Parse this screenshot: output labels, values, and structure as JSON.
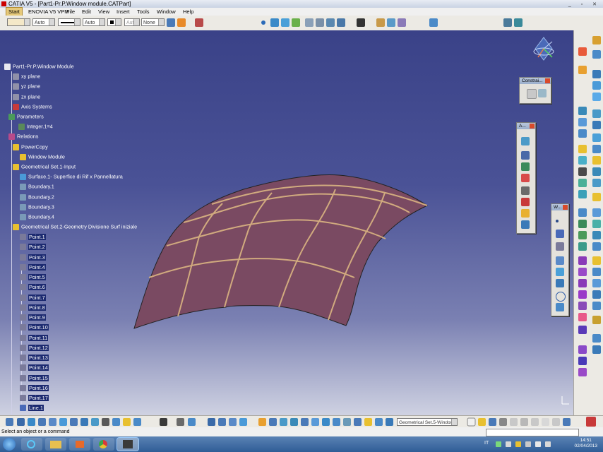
{
  "window": {
    "title": "CATIA V5 - [Part1-Pr.P.Window module.CATPart]",
    "controls": "_ ▫ ✕"
  },
  "menu": {
    "items": [
      "Start",
      "ENOVIA V5 VPM",
      "File",
      "Edit",
      "View",
      "Insert",
      "Tools",
      "Window",
      "Help"
    ]
  },
  "graphic_properties": {
    "line_type": "Auto",
    "thickness": "Auto",
    "weight_value": "Auto",
    "layer": "None"
  },
  "tree": {
    "root": "Part1-Pr.P.Window Module",
    "nodes": [
      "xy plane",
      "yz plane",
      "zx plane",
      "Axis Systems",
      "Parameters",
      "Integer.1=4",
      "Relations",
      "PowerCopy",
      "Window Module",
      "Geometrical Set.1-Input",
      "Surface.1- Superfice di Rif x Pannellatura",
      "Boundary.1",
      "Boundary.2",
      "Boundary.3",
      "Boundary.4",
      "Geometrical Set.2-Geometry Divisione Surf iniziale",
      "Point.1",
      "Point.2",
      "Point.3",
      "Point.4",
      "Point.5",
      "Point.6",
      "Point.7",
      "Point.8",
      "Point.9",
      "Point.10",
      "Point.11",
      "Point.12",
      "Point.13",
      "Point.14",
      "Point.15",
      "Point.16",
      "Point.17",
      "Line.1"
    ]
  },
  "palettes": {
    "constraint_title": "Constrai...",
    "analysis_title": "A...",
    "wireframe_title": "W..."
  },
  "bottom": {
    "current_set": "Geometrical Set.5-Window"
  },
  "status": {
    "prompt": "Select an object or a command"
  },
  "taskbar": {
    "lang": "IT",
    "time": "14:51",
    "date": "02/04/2013"
  }
}
